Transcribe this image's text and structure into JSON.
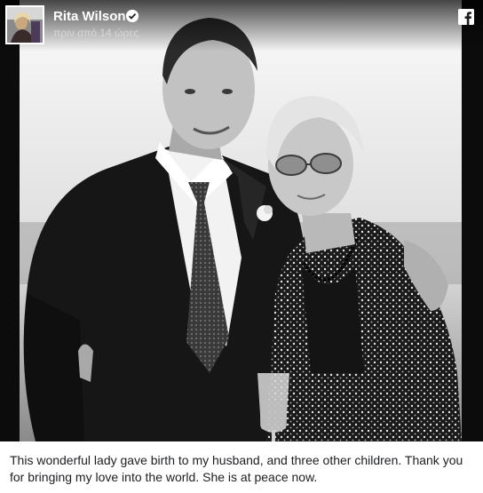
{
  "post": {
    "author_name": "Rita Wilson",
    "timestamp": "πριν από 14 ώρες",
    "caption": "This wonderful lady gave birth to my husband, and three other children. Thank you for bringing my love into the world. She is at peace now."
  },
  "icons": {
    "verified": "verified-check-icon",
    "platform": "facebook-icon"
  },
  "colors": {
    "caption_text": "#1c1e21",
    "photo_background": "#0c0c0c",
    "header_text": "#ffffff"
  }
}
